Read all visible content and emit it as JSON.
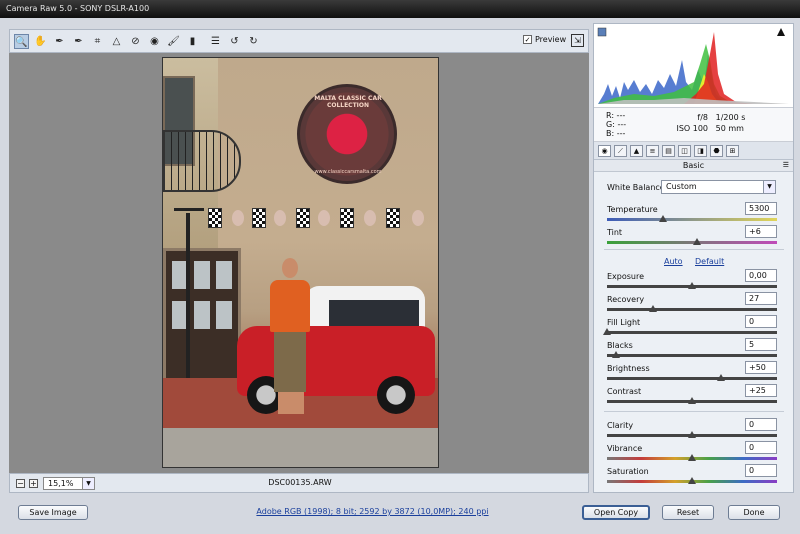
{
  "window": {
    "title": "Camera Raw 5.0  -  SONY DSLR-A100"
  },
  "toolbar": {
    "tools": [
      {
        "name": "zoom-tool",
        "glyph": "🔍"
      },
      {
        "name": "hand-tool",
        "glyph": "✋"
      },
      {
        "name": "white-balance-tool",
        "glyph": "✒"
      },
      {
        "name": "color-sampler-tool",
        "glyph": "✒"
      },
      {
        "name": "crop-tool",
        "glyph": "⌗"
      },
      {
        "name": "straighten-tool",
        "glyph": "△"
      },
      {
        "name": "spot-removal-tool",
        "glyph": "⊘"
      },
      {
        "name": "red-eye-tool",
        "glyph": "◉"
      },
      {
        "name": "adjustment-brush-tool",
        "glyph": "🖌"
      },
      {
        "name": "graduated-filter-tool",
        "glyph": "▮"
      },
      {
        "name": "preferences-tool",
        "glyph": "☰"
      },
      {
        "name": "rotate-ccw-tool",
        "glyph": "↺"
      },
      {
        "name": "rotate-cw-tool",
        "glyph": "↻"
      }
    ],
    "preview_label": "Preview",
    "preview_checked": true
  },
  "bottombar": {
    "zoom_value": "15,1%",
    "filename": "DSC00135.ARW"
  },
  "footer": {
    "save_label": "Save Image",
    "workflow_link": "Adobe RGB (1998); 8 bit; 2592 by 3872 (10,0MP); 240 ppi",
    "open_label": "Open Copy",
    "reset_label": "Reset",
    "done_label": "Done"
  },
  "info": {
    "r": "R:  ---",
    "g": "G:  ---",
    "b": "B:  ---",
    "aperture": "f/8",
    "shutter": "1/200 s",
    "iso": "ISO 100",
    "focal": "50 mm"
  },
  "panel": {
    "section_title": "Basic",
    "wb_label": "White Balance:",
    "wb_value": "Custom",
    "auto_label": "Auto",
    "default_label": "Default",
    "sliders": [
      {
        "key": "temperature",
        "label": "Temperature",
        "value": "5300",
        "pos": 0.33,
        "gradient": "linear-gradient(90deg,#3d5cb8,#e0d55a)"
      },
      {
        "key": "tint",
        "label": "Tint",
        "value": "+6",
        "pos": 0.53,
        "gradient": "linear-gradient(90deg,#3aa13a,#c04bb9)"
      },
      {
        "key": "exposure",
        "label": "Exposure",
        "value": "0,00",
        "pos": 0.5,
        "gradient": "#444"
      },
      {
        "key": "recovery",
        "label": "Recovery",
        "value": "27",
        "pos": 0.27,
        "gradient": "#444"
      },
      {
        "key": "fill-light",
        "label": "Fill Light",
        "value": "0",
        "pos": 0.0,
        "gradient": "#444"
      },
      {
        "key": "blacks",
        "label": "Blacks",
        "value": "5",
        "pos": 0.05,
        "gradient": "#444"
      },
      {
        "key": "brightness",
        "label": "Brightness",
        "value": "+50",
        "pos": 0.67,
        "gradient": "#444"
      },
      {
        "key": "contrast",
        "label": "Contrast",
        "value": "+25",
        "pos": 0.5,
        "gradient": "#444"
      },
      {
        "key": "clarity",
        "label": "Clarity",
        "value": "0",
        "pos": 0.5,
        "gradient": "#444"
      },
      {
        "key": "vibrance",
        "label": "Vibrance",
        "value": "0",
        "pos": 0.5,
        "gradient": "linear-gradient(90deg,#777,#c43c3c,#d4a02a,#48a048,#3c6cc4,#8a3cc4)"
      },
      {
        "key": "saturation",
        "label": "Saturation",
        "value": "0",
        "pos": 0.5,
        "gradient": "linear-gradient(90deg,#777,#c43c3c,#d4a02a,#48a048,#3c6cc4,#8a3cc4)"
      }
    ]
  },
  "photo": {
    "sign_top": "MALTA CLASSIC CAR COLLECTION",
    "sign_bottom": "www.classiccarsmalta.com"
  },
  "colors": {
    "accent": "#3b5f95",
    "link": "#1a3f9c",
    "canvas": "#8a8a8a"
  }
}
